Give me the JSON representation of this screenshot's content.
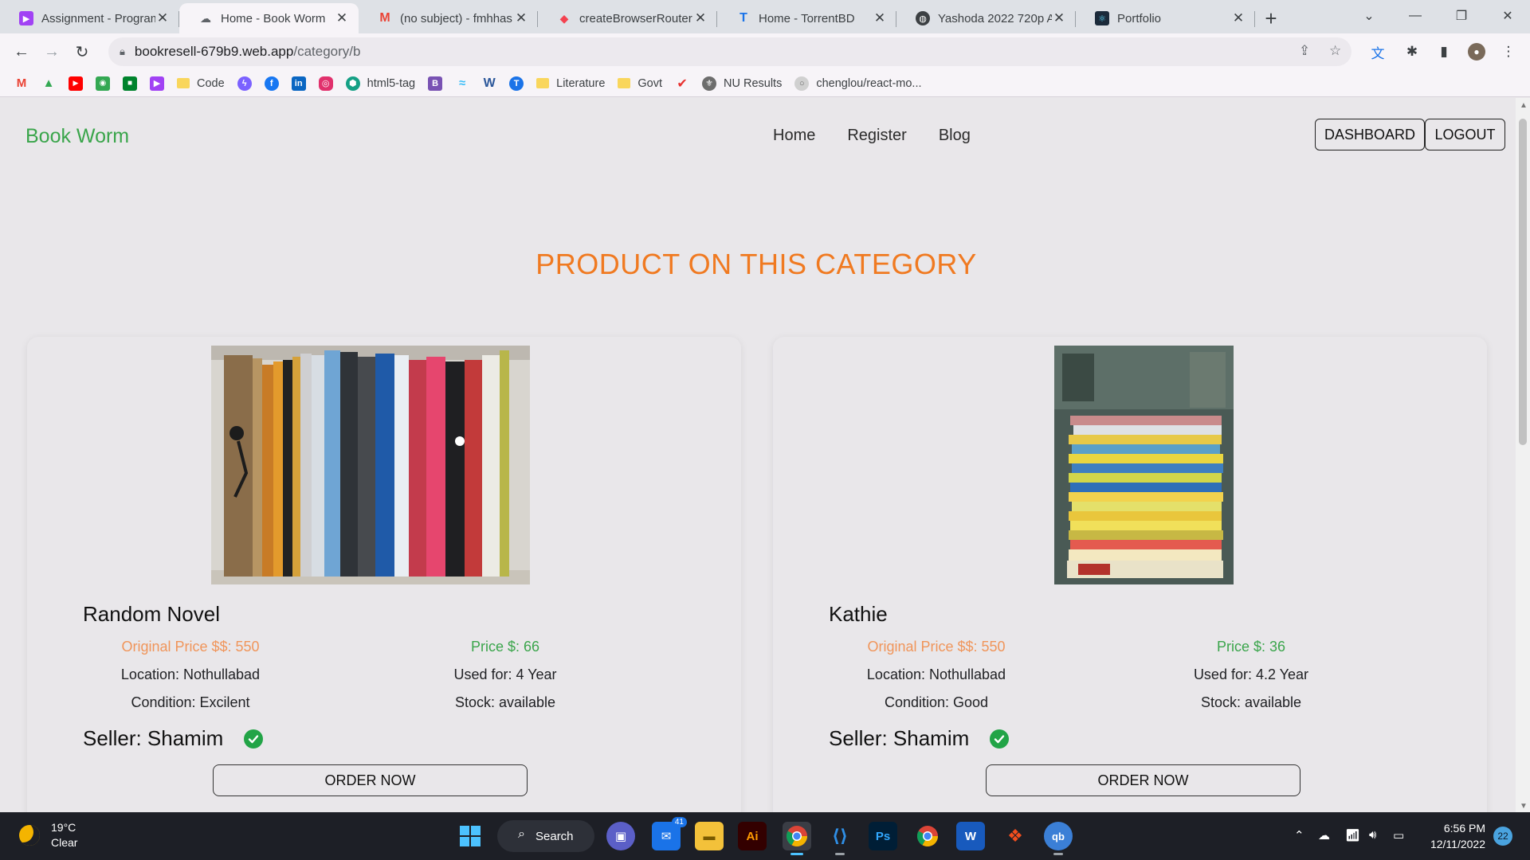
{
  "browser": {
    "tabs": [
      {
        "title": "Assignment - Program",
        "icon": "purple-play-icon",
        "color": "#a142f4"
      },
      {
        "title": "Home - Book Worm",
        "icon": "book-icon",
        "color": "#5f6368"
      },
      {
        "title": "(no subject) - fmhhas",
        "icon": "gmail-icon",
        "color": "#ea4335"
      },
      {
        "title": "createBrowserRouter",
        "icon": "router-icon",
        "color": "#f44250"
      },
      {
        "title": "Home - TorrentBD",
        "icon": "torrentbd-icon",
        "color": "#1a73e8"
      },
      {
        "title": "Yashoda 2022 720p A",
        "icon": "globe-icon",
        "color": "#3c4043"
      },
      {
        "title": "Portfolio",
        "icon": "react-icon",
        "color": "#1b2a3a"
      }
    ],
    "url_host": "bookresell-679b9.web.app",
    "url_path": "/category/b",
    "bookmarks": [
      {
        "label": "",
        "icon": "gmail-icon",
        "color": "#ea4335"
      },
      {
        "label": "",
        "icon": "drive-icon",
        "color": "#34a853"
      },
      {
        "label": "",
        "icon": "youtube-icon",
        "color": "#ff0000"
      },
      {
        "label": "",
        "icon": "maps-icon",
        "color": "#4285f4"
      },
      {
        "label": "",
        "icon": "meet-icon",
        "color": "#00832d"
      },
      {
        "label": "",
        "icon": "purple-play-icon",
        "color": "#a142f4"
      },
      {
        "label": "Code",
        "icon": "folder-icon",
        "color": "#f9d65c"
      },
      {
        "label": "",
        "icon": "messenger-icon",
        "color": "#7b61ff"
      },
      {
        "label": "",
        "icon": "facebook-icon",
        "color": "#1877f2"
      },
      {
        "label": "",
        "icon": "linkedin-icon",
        "color": "#0a66c2"
      },
      {
        "label": "",
        "icon": "instagram-icon",
        "color": "#e1306c"
      },
      {
        "label": "html5-tag",
        "icon": "html5-icon",
        "color": "#15a085"
      },
      {
        "label": "",
        "icon": "bootstrap-icon",
        "color": "#7952b3"
      },
      {
        "label": "",
        "icon": "tailwind-icon",
        "color": "#38bdf8"
      },
      {
        "label": "",
        "icon": "w-icon",
        "color": "#2b579a"
      },
      {
        "label": "",
        "icon": "torrentbd-icon",
        "color": "#1a73e8"
      },
      {
        "label": "Literature",
        "icon": "folder-icon",
        "color": "#f9d65c"
      },
      {
        "label": "Govt",
        "icon": "folder-icon",
        "color": "#f9d65c"
      },
      {
        "label": "",
        "icon": "vivaldi-icon",
        "color": "#e8312f"
      },
      {
        "label": "NU Results",
        "icon": "nu-icon",
        "color": "#6d6d6d"
      },
      {
        "label": "chenglou/react-mo...",
        "icon": "github-icon",
        "color": "#d0d0d0"
      }
    ]
  },
  "site": {
    "brand": "Book Worm",
    "nav": [
      "Home",
      "Register",
      "Blog"
    ],
    "dashboard_label": "DASHBOARD",
    "logout_label": "LOGOUT",
    "section_title": "PRODUCT ON THIS CATEGORY",
    "products": [
      {
        "name": "Random Novel",
        "original_price": "Original Price $$: 550",
        "price": "Price $: 66",
        "location": "Location: Nothullabad",
        "used": "Used for: 4 Year",
        "condition": "Condition: Excilent",
        "stock": "Stock: available",
        "seller": "Seller: Shamim",
        "order_label": "ORDER NOW"
      },
      {
        "name": "Kathie",
        "original_price": "Original Price $$: 550",
        "price": "Price $: 36",
        "location": "Location: Nothullabad",
        "used": "Used for: 4.2 Year",
        "condition": "Condition: Good",
        "stock": "Stock: available",
        "seller": "Seller: Shamim",
        "order_label": "ORDER NOW"
      }
    ]
  },
  "taskbar": {
    "temperature": "19°C",
    "weather": "Clear",
    "search_label": "Search",
    "mail_badge": "41",
    "time": "6:56 PM",
    "date": "12/11/2022",
    "notifications": "22"
  }
}
